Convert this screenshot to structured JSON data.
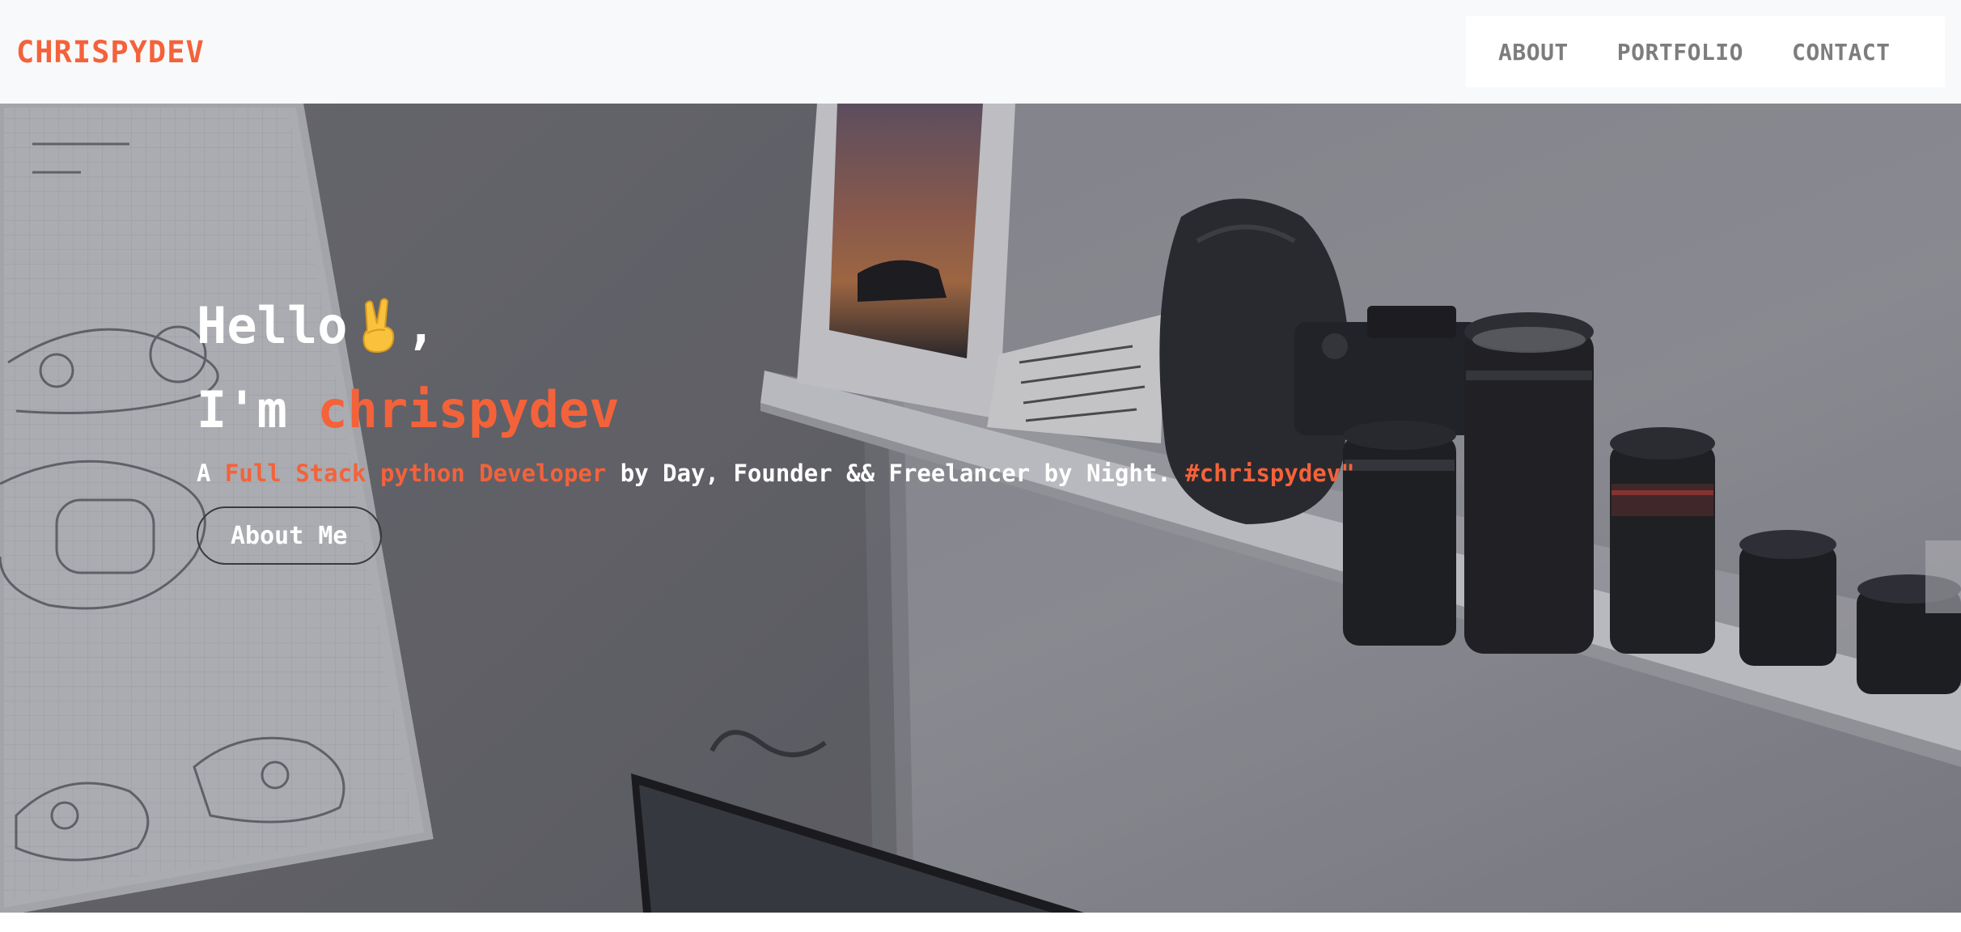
{
  "navbar": {
    "brand": "CHRISPYDEV",
    "links": [
      {
        "label": "ABOUT"
      },
      {
        "label": "PORTFOLIO"
      },
      {
        "label": "CONTACT"
      }
    ]
  },
  "hero": {
    "greeting_word": "Hello",
    "greeting_emoji": "✌",
    "greeting_punct": ",",
    "intro_prefix": "I'm ",
    "intro_name": "chrispydev",
    "tagline": {
      "prefix": "A ",
      "role": "Full Stack python Developer",
      "middle": " by Day, Founder && Freelancer by Night. ",
      "hashtag": "#chrispydev\""
    },
    "button_label": "About Me"
  },
  "colors": {
    "accent": "#f4623a",
    "nav_link": "#7d7d7d",
    "navbar_bg": "#f8f9fa"
  },
  "icons": {
    "greeting_emoji": "victory-hand-icon"
  }
}
